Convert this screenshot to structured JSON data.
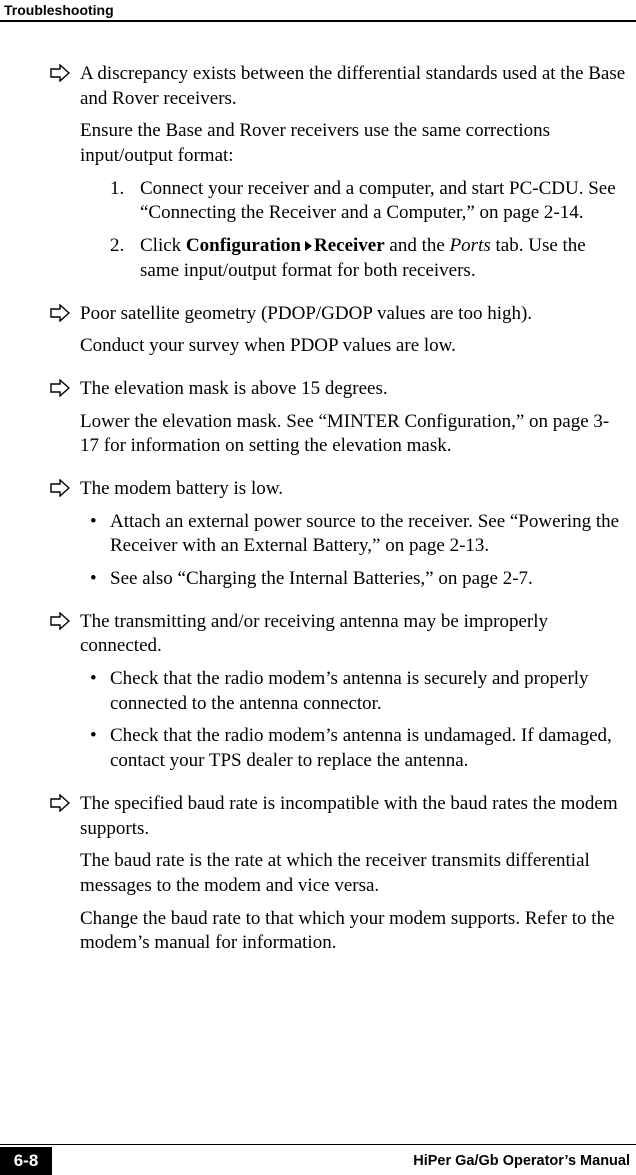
{
  "header": {
    "title": "Troubleshooting"
  },
  "items": [
    {
      "head": "A discrepancy exists between the differential standards used at the Base and Rover receivers.",
      "para1": "Ensure the Base and Rover receivers use the same corrections input/output format:",
      "num1": {
        "n": "1.",
        "a": "Connect your receiver and a computer, and start PC-CDU. See “Connecting the Receiver and a Computer,” on page 2-14."
      },
      "num2": {
        "n": "2.",
        "pre": "Click ",
        "b1": "Configuration",
        "b2": "Receiver",
        "mid": " and the ",
        "it": "Ports",
        "post": " tab. Use the same input/output format for both receivers."
      }
    },
    {
      "head": "Poor satellite geometry (PDOP/GDOP values are too high).",
      "para1": "Conduct your survey when PDOP values are low."
    },
    {
      "head": "The elevation mask is above 15 degrees.",
      "para1": "Lower the elevation mask. See “MINTER Configuration,” on page 3-17 for information on setting the elevation mask."
    },
    {
      "head": "The modem battery is low.",
      "b1": "Attach an external power source to the receiver. See “Powering the Receiver with an External Battery,” on page 2-13.",
      "b2": "See also “Charging the Internal Batteries,” on page 2-7."
    },
    {
      "head": "The transmitting and/or receiving antenna may be improperly connected.",
      "b1": "Check that the radio modem’s antenna is securely and properly connected to the antenna connector.",
      "b2": "Check that the radio modem’s antenna is undamaged. If damaged, contact your TPS dealer to replace the antenna."
    },
    {
      "head": "The specified baud rate is incompatible with the baud rates the modem supports.",
      "para1": "The baud rate is the rate at which the receiver transmits differential messages to the modem and vice versa.",
      "para2": "Change the baud rate to that which your modem supports. Refer to the modem’s manual for information."
    }
  ],
  "footer": {
    "page": "6-8",
    "title": "HiPer Ga/Gb Operator’s Manual"
  },
  "glyphs": {
    "bullet": "•"
  }
}
